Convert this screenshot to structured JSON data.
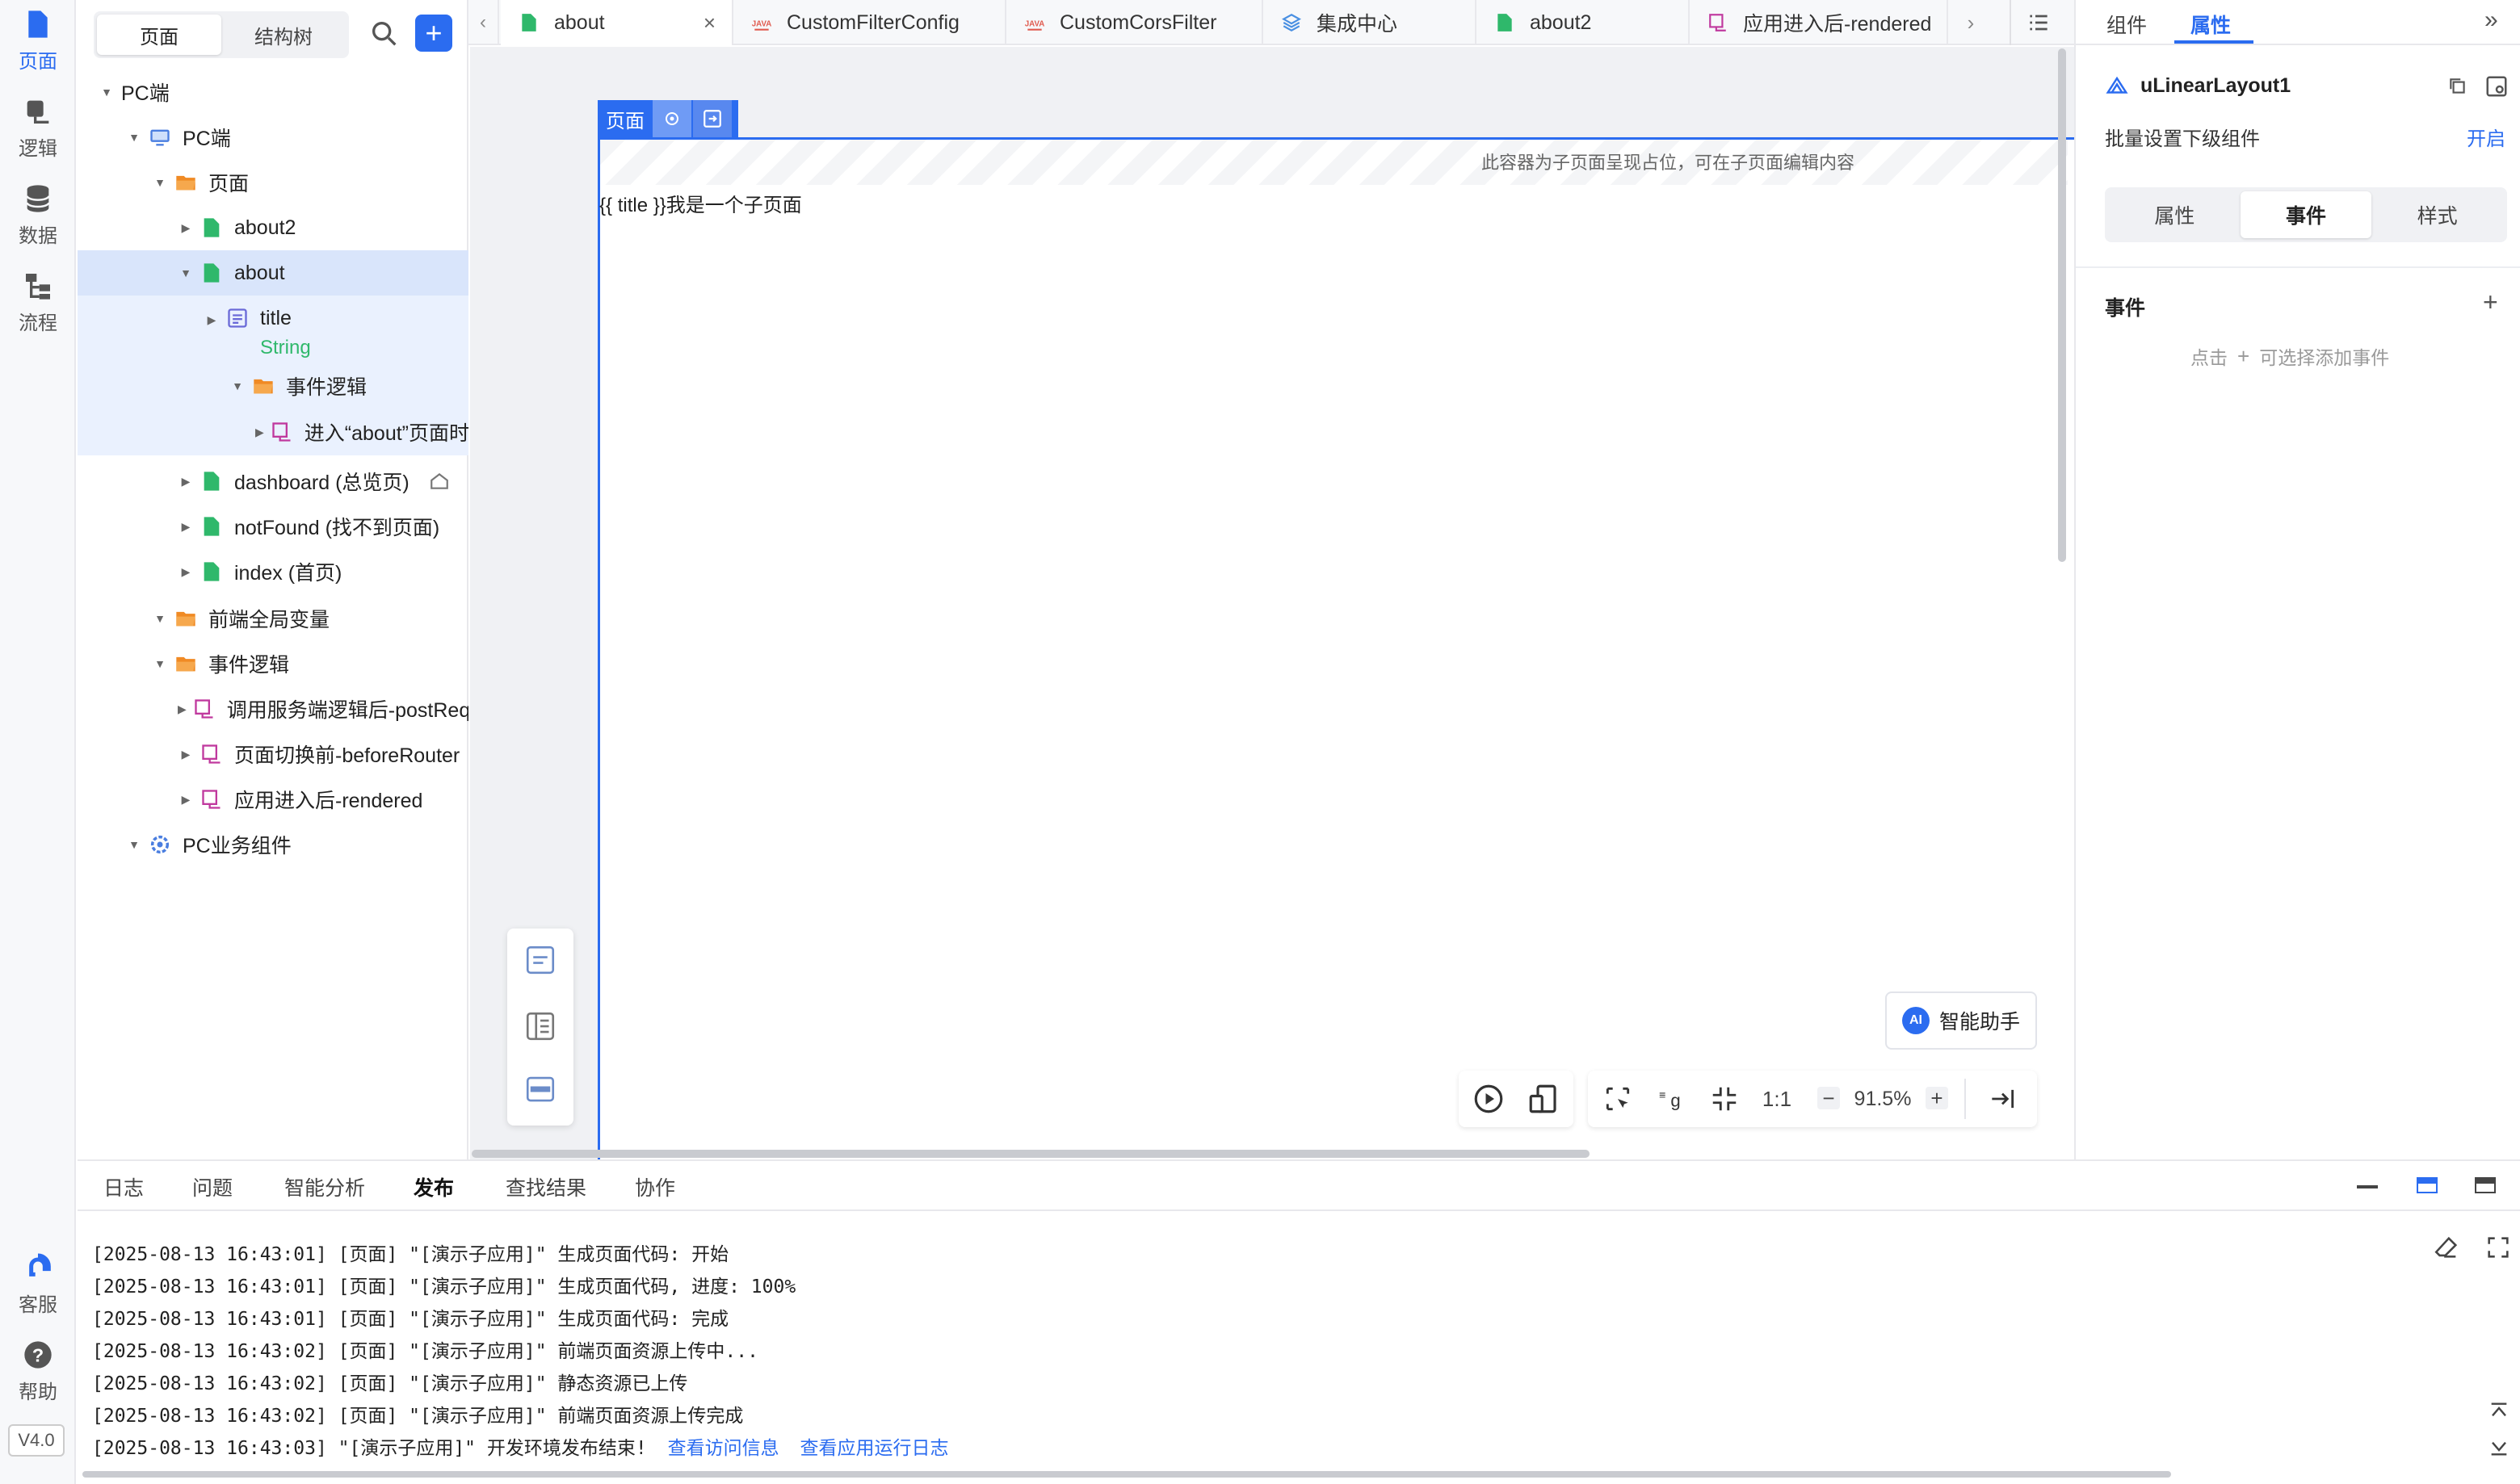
{
  "sidebar": {
    "items": [
      {
        "label": "页面",
        "icon": "page-icon"
      },
      {
        "label": "逻辑",
        "icon": "logic-icon"
      },
      {
        "label": "数据",
        "icon": "database-icon"
      },
      {
        "label": "流程",
        "icon": "flow-icon"
      }
    ],
    "bottom": [
      {
        "label": "客服",
        "icon": "support-icon"
      },
      {
        "label": "帮助",
        "icon": "help-icon"
      }
    ],
    "version": "V4.0"
  },
  "tree_panel": {
    "segments": [
      "页面",
      "结构树"
    ],
    "nodes": [
      {
        "label": "PC端"
      },
      {
        "label": "PC端"
      },
      {
        "label": "页面"
      },
      {
        "label": "about2"
      },
      {
        "label": "about"
      },
      {
        "label": "title"
      },
      {
        "label": "String"
      },
      {
        "label": "事件逻辑"
      },
      {
        "label": "进入“about”页面时 - rendered"
      },
      {
        "label": "dashboard (总览页)"
      },
      {
        "label": "notFound (找不到页面)"
      },
      {
        "label": "index (首页)"
      },
      {
        "label": "前端全局变量"
      },
      {
        "label": "事件逻辑"
      },
      {
        "label": "调用服务端逻辑后-postRequest"
      },
      {
        "label": "页面切换前-beforeRouter"
      },
      {
        "label": "应用进入后-rendered"
      },
      {
        "label": "PC业务组件"
      }
    ]
  },
  "tabs": [
    {
      "label": "about",
      "active": true
    },
    {
      "label": "CustomFilterConfig"
    },
    {
      "label": "CustomCorsFilter"
    },
    {
      "label": "集成中心"
    },
    {
      "label": "about2"
    },
    {
      "label": "应用进入后-rendered"
    }
  ],
  "canvas": {
    "page_tag": "页面",
    "placeholder_hint": "此容器为子页面呈现占位，可在子页面编辑内容",
    "content_text": "{{ title }}我是一个子页面",
    "ai_button": "智能助手",
    "ai_badge": "AI",
    "zoom_ratio": "1:1",
    "zoom": "91.5%"
  },
  "right_panel": {
    "tabs": [
      "组件",
      "属性"
    ],
    "active_tab": "属性",
    "component_name": "uLinearLayout1",
    "batch_label": "批量设置下级组件",
    "batch_action": "开启",
    "sub_tabs": [
      "属性",
      "事件",
      "样式"
    ],
    "active_sub_tab": "事件",
    "events_title": "事件",
    "events_hint_pre": "点击",
    "events_hint_post": "可选择添加事件"
  },
  "bottom_panel": {
    "tabs": [
      "日志",
      "问题",
      "智能分析",
      "发布",
      "查找结果",
      "协作"
    ],
    "active_tab": "发布",
    "logs": [
      "[2025-08-13 16:43:01] [页面] \"[演示子应用]\" 生成页面代码: 开始",
      "[2025-08-13 16:43:01] [页面] \"[演示子应用]\" 生成页面代码, 进度: 100%",
      "[2025-08-13 16:43:01] [页面] \"[演示子应用]\" 生成页面代码: 完成",
      "[2025-08-13 16:43:02] [页面] \"[演示子应用]\" 前端页面资源上传中...",
      "[2025-08-13 16:43:02] [页面] \"[演示子应用]\" 静态资源已上传",
      "[2025-08-13 16:43:02] [页面] \"[演示子应用]\" 前端页面资源上传完成",
      "[2025-08-13 16:43:03]  \"[演示子应用]\" 开发环境发布结束!"
    ],
    "links": [
      "查看访问信息",
      "查看应用运行日志"
    ]
  },
  "colors": {
    "accent": "#2b6cf0",
    "page_green": "#2fb86b",
    "folder_orange": "#f08a24",
    "logic_purple": "#c0399e",
    "java_red": "#e05a4e"
  }
}
